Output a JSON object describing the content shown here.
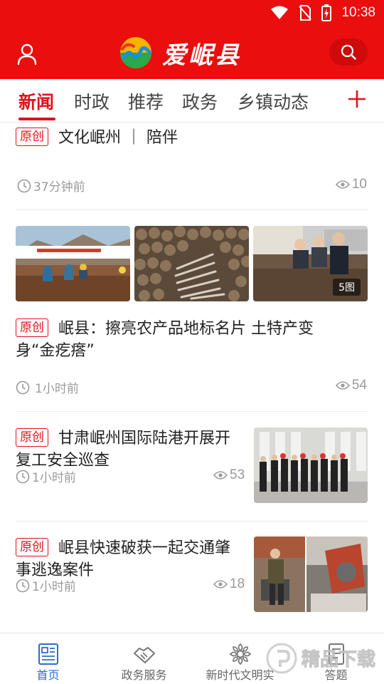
{
  "status_bar": {
    "time": "10:38"
  },
  "header": {
    "app_name": "爱岷县"
  },
  "tabs": [
    {
      "label": "新闻",
      "active": true
    },
    {
      "label": "时政",
      "active": false
    },
    {
      "label": "推荐",
      "active": false
    },
    {
      "label": "政务",
      "active": false
    },
    {
      "label": "乡镇动态",
      "active": false
    }
  ],
  "feed": [
    {
      "badge": "原创",
      "title": "文化岷州 ｜ 陪伴",
      "time": "37分钟前",
      "views": "10"
    },
    {
      "badge": "原创",
      "title": "岷县：擦亮农产品地标名片 土特产变身“金疙瘩”",
      "time": "1小时前",
      "views": "54",
      "image_count": "5图"
    },
    {
      "badge": "原创",
      "title": "甘肃岷州国际陆港开展开复工安全巡查",
      "time": "1小时前",
      "views": "53"
    },
    {
      "badge": "原创",
      "title": "岷县快速破获一起交通肇事逃逸案件",
      "time": "1小时前",
      "views": "18"
    }
  ],
  "bottom_nav": [
    {
      "label": "首页",
      "icon": "news-list-icon",
      "active": true
    },
    {
      "label": "政务服务",
      "icon": "handshake-icon",
      "active": false
    },
    {
      "label": "新时代文明实",
      "icon": "flower-icon",
      "active": false
    },
    {
      "label": "答题",
      "icon": "document-icon",
      "active": false
    }
  ],
  "watermark": {
    "text": "精品下载"
  },
  "colors": {
    "brand_red": "#ea0e0e",
    "accent_red": "#e0121a",
    "nav_active_blue": "#2b6cd4"
  }
}
